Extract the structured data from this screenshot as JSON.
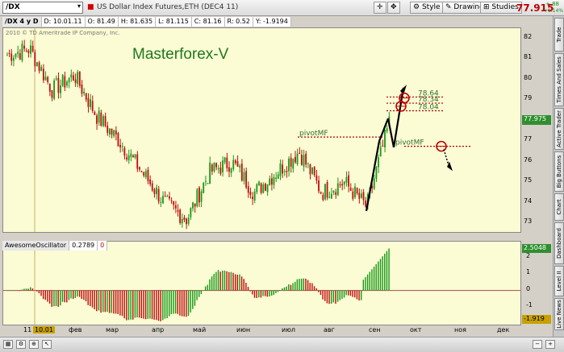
{
  "toolbar": {
    "symbol": "/DX",
    "title": "US Dollar Index Futures,ETH (DEC4 11)",
    "style_label": "Style",
    "drawings_label": "Drawings",
    "studies_label": "Studies",
    "last_price": "77.915",
    "change": "+.88",
    "change_pct": "+1.14%"
  },
  "infobar": {
    "chart_label": "/DX 4 y D",
    "date": "D: 10.01.11",
    "open": "O: 81.49",
    "high": "H: 81.635",
    "low": "L: 81.115",
    "close": "C: 81.16",
    "range": "R: 0.52",
    "y": "Y: -1.9194"
  },
  "main": {
    "copyright": "2010 © TD Ameritrade IP Company, Inc.",
    "watermark": "Masterforex-V",
    "annotations": [
      {
        "text": "pivotMF",
        "price": 77.2
      },
      {
        "text": "pivotMF",
        "price": 76.75
      },
      {
        "text": "78.64",
        "price": 79.15
      },
      {
        "text": "78.34",
        "price": 78.85
      },
      {
        "text": "78.04",
        "price": 78.48
      }
    ],
    "current_price_tag": "77.975",
    "price_ticks": [
      "82",
      "81",
      "80",
      "79",
      "78",
      "77",
      "76",
      "75",
      "74",
      "73"
    ]
  },
  "oscillator": {
    "name": "AwesomeOscillator",
    "value": "0.2789",
    "extra": "0",
    "current_tag": "2.5048",
    "low_tag": "-1.919",
    "ticks": [
      "2",
      "1",
      "0",
      "-1"
    ]
  },
  "date_axis": {
    "labels": [
      "11",
      "10.01",
      "фев",
      "мар",
      "апр",
      "май",
      "июн",
      "июл",
      "авг",
      "сен",
      "окт",
      "ноя",
      "дек"
    ]
  },
  "right_tabs": [
    "Trade",
    "Times And Sales",
    "Active Trader",
    "Big Buttons",
    "Chart",
    "Dashboard",
    "Level II",
    "Live News"
  ],
  "colors": {
    "panel_bg": "#fbfbd4",
    "bull": "#1a9a1a",
    "bear": "#c01010",
    "price_tag": "#2f8f2f",
    "last_price": "#c00000"
  },
  "chart_data": {
    "type": "candlestick",
    "timeframe": "daily",
    "ylim": [
      72.5,
      82.5
    ],
    "close_path": [
      [
        "10.01",
        81.2
      ],
      [
        "янв",
        81.5
      ],
      [
        "фев",
        79.5
      ],
      [
        "фев",
        80.2
      ],
      [
        "мар",
        78.2
      ],
      [
        "мар",
        77.0
      ],
      [
        "апр",
        75.5
      ],
      [
        "апр",
        74.0
      ],
      [
        "май",
        73.2
      ],
      [
        "май",
        75.5
      ],
      [
        "июн",
        76.0
      ],
      [
        "июн",
        74.5
      ],
      [
        "июл",
        75.5
      ],
      [
        "июл",
        76.5
      ],
      [
        "авг",
        74.5
      ],
      [
        "авг",
        75.0
      ],
      [
        "сен",
        73.8
      ],
      [
        "сен",
        77.9
      ]
    ],
    "oscillator_ylim": [
      -2.2,
      3
    ],
    "oscillator_last": 2.5048
  }
}
